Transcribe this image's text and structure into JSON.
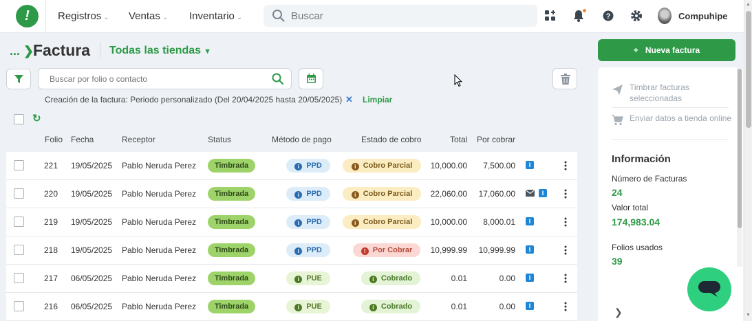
{
  "nav": {
    "items": [
      {
        "label": "Registros"
      },
      {
        "label": "Ventas"
      },
      {
        "label": "Inventario"
      }
    ],
    "search_placeholder": "Buscar",
    "user_name": "Compuhipe",
    "icons": [
      "apps-icon",
      "bell-icon",
      "help-icon",
      "gear-icon"
    ]
  },
  "page": {
    "crumb": "...",
    "title": "Factura",
    "store_filter": "Todas las tiendas"
  },
  "filters": {
    "search_placeholder": "Buscar por folio o contacto",
    "active_filter": "Creación de la factura: Periodo personalizado (Del 20/04/2025 hasta 20/05/2025)",
    "clear_x": "✕",
    "clear_label": "Limpiar"
  },
  "table": {
    "headers": {
      "folio": "Folio",
      "fecha": "Fecha",
      "receptor": "Receptor",
      "status": "Status",
      "metodo": "Método de pago",
      "estado": "Estado de cobro",
      "total": "Total",
      "por_cobrar": "Por cobrar"
    },
    "rows": [
      {
        "folio": "221",
        "fecha": "19/05/2025",
        "receptor": "Pablo Neruda Perez",
        "status": "Timbrada",
        "metodo": "PPD",
        "estado": "Cobro Parcial",
        "total": "10,000.00",
        "por_cobrar": "7,500.00",
        "badge": "I"
      },
      {
        "folio": "220",
        "fecha": "19/05/2025",
        "receptor": "Pablo Neruda Perez",
        "status": "Timbrada",
        "metodo": "PPD",
        "estado": "Cobro Parcial",
        "total": "22,060.00",
        "por_cobrar": "17,060.00",
        "badge": "I"
      },
      {
        "folio": "219",
        "fecha": "19/05/2025",
        "receptor": "Pablo Neruda Perez",
        "status": "Timbrada",
        "metodo": "PPD",
        "estado": "Cobro Parcial",
        "total": "10,000.00",
        "por_cobrar": "8,000.01",
        "badge": "I"
      },
      {
        "folio": "218",
        "fecha": "19/05/2025",
        "receptor": "Pablo Neruda Perez",
        "status": "Timbrada",
        "metodo": "PPD",
        "estado": "Por Cobrar",
        "total": "10,999.99",
        "por_cobrar": "10,999.99",
        "badge": "I"
      },
      {
        "folio": "217",
        "fecha": "06/05/2025",
        "receptor": "Pablo Neruda Perez",
        "status": "Timbrada",
        "metodo": "PUE",
        "estado": "Cobrado",
        "total": "0.01",
        "por_cobrar": "0.00",
        "badge": "I"
      },
      {
        "folio": "216",
        "fecha": "06/05/2025",
        "receptor": "Pablo Neruda Perez",
        "status": "Timbrada",
        "metodo": "PUE",
        "estado": "Cobrado",
        "total": "0.01",
        "por_cobrar": "0.00",
        "badge": "I"
      }
    ]
  },
  "side": {
    "new_button": "Nueva factura",
    "new_button_plus": "+",
    "actions": [
      {
        "label": "Timbrar facturas seleccionadas"
      },
      {
        "label": "Enviar datos a tienda online"
      }
    ],
    "info_title": "Información",
    "stats": [
      {
        "label": "Número de Facturas",
        "value": "24"
      },
      {
        "label": "Valor total",
        "value": "174,983.04"
      },
      {
        "label": "Folios usados",
        "value": "39"
      }
    ]
  },
  "colors": {
    "brand_green": "#2e9a48",
    "timbrada": "#9ed36a",
    "info_blue": "#1e86d6",
    "chat_green": "#2ecf7f"
  }
}
